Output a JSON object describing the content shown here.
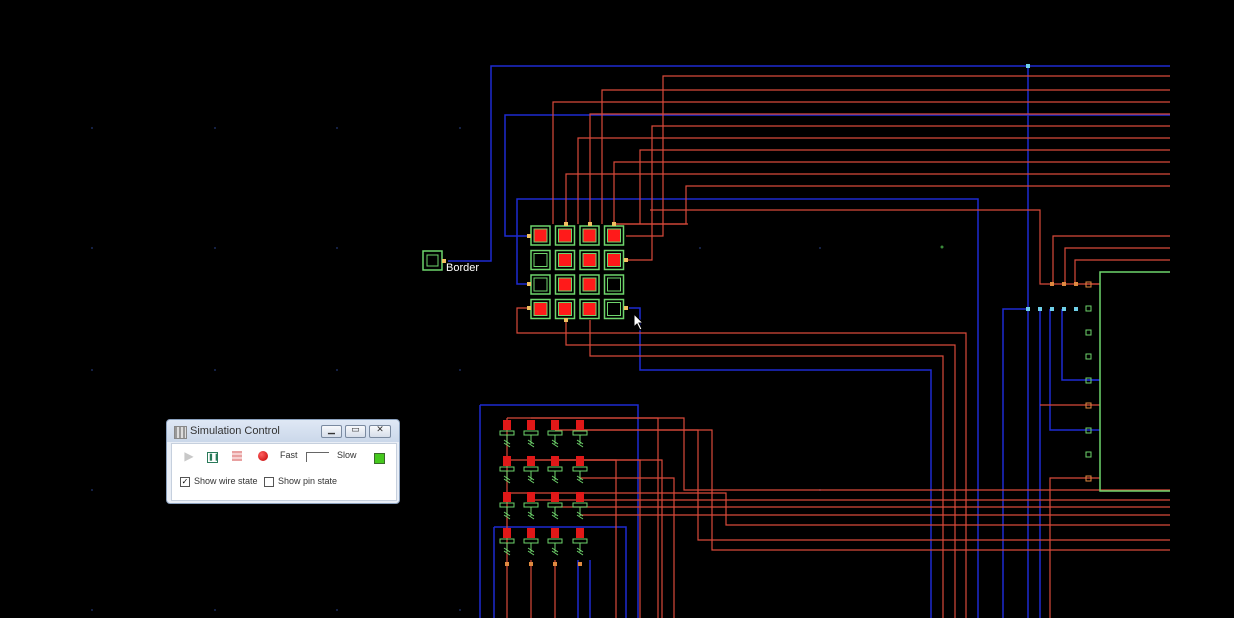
{
  "canvas": {
    "background": "#000000",
    "wire_blue": "#1e2bd1",
    "wire_red": "#d8493a",
    "component_green": "#6ed56c",
    "led_on": "#ff1a1a",
    "border_label": "Border"
  },
  "sim_window": {
    "title": "Simulation Control",
    "fast_label": "Fast",
    "slow_label": "Slow",
    "show_wire_state_label": "Show wire state",
    "show_pin_state_label": "Show pin state",
    "show_wire_state_checked": true,
    "show_pin_state_checked": false,
    "status_color": "#45c81e",
    "icons": {
      "play": "play-icon",
      "pause": "pause-icon",
      "step": "step-icon",
      "record": "record-icon",
      "minimize": "minimize-icon",
      "maximize": "maximize-icon",
      "close": "close-icon"
    }
  },
  "led_grid": {
    "rows": [
      [
        true,
        true,
        true,
        true
      ],
      [
        false,
        true,
        true,
        true
      ],
      [
        false,
        true,
        true,
        false
      ],
      [
        true,
        true,
        true,
        false
      ]
    ]
  }
}
